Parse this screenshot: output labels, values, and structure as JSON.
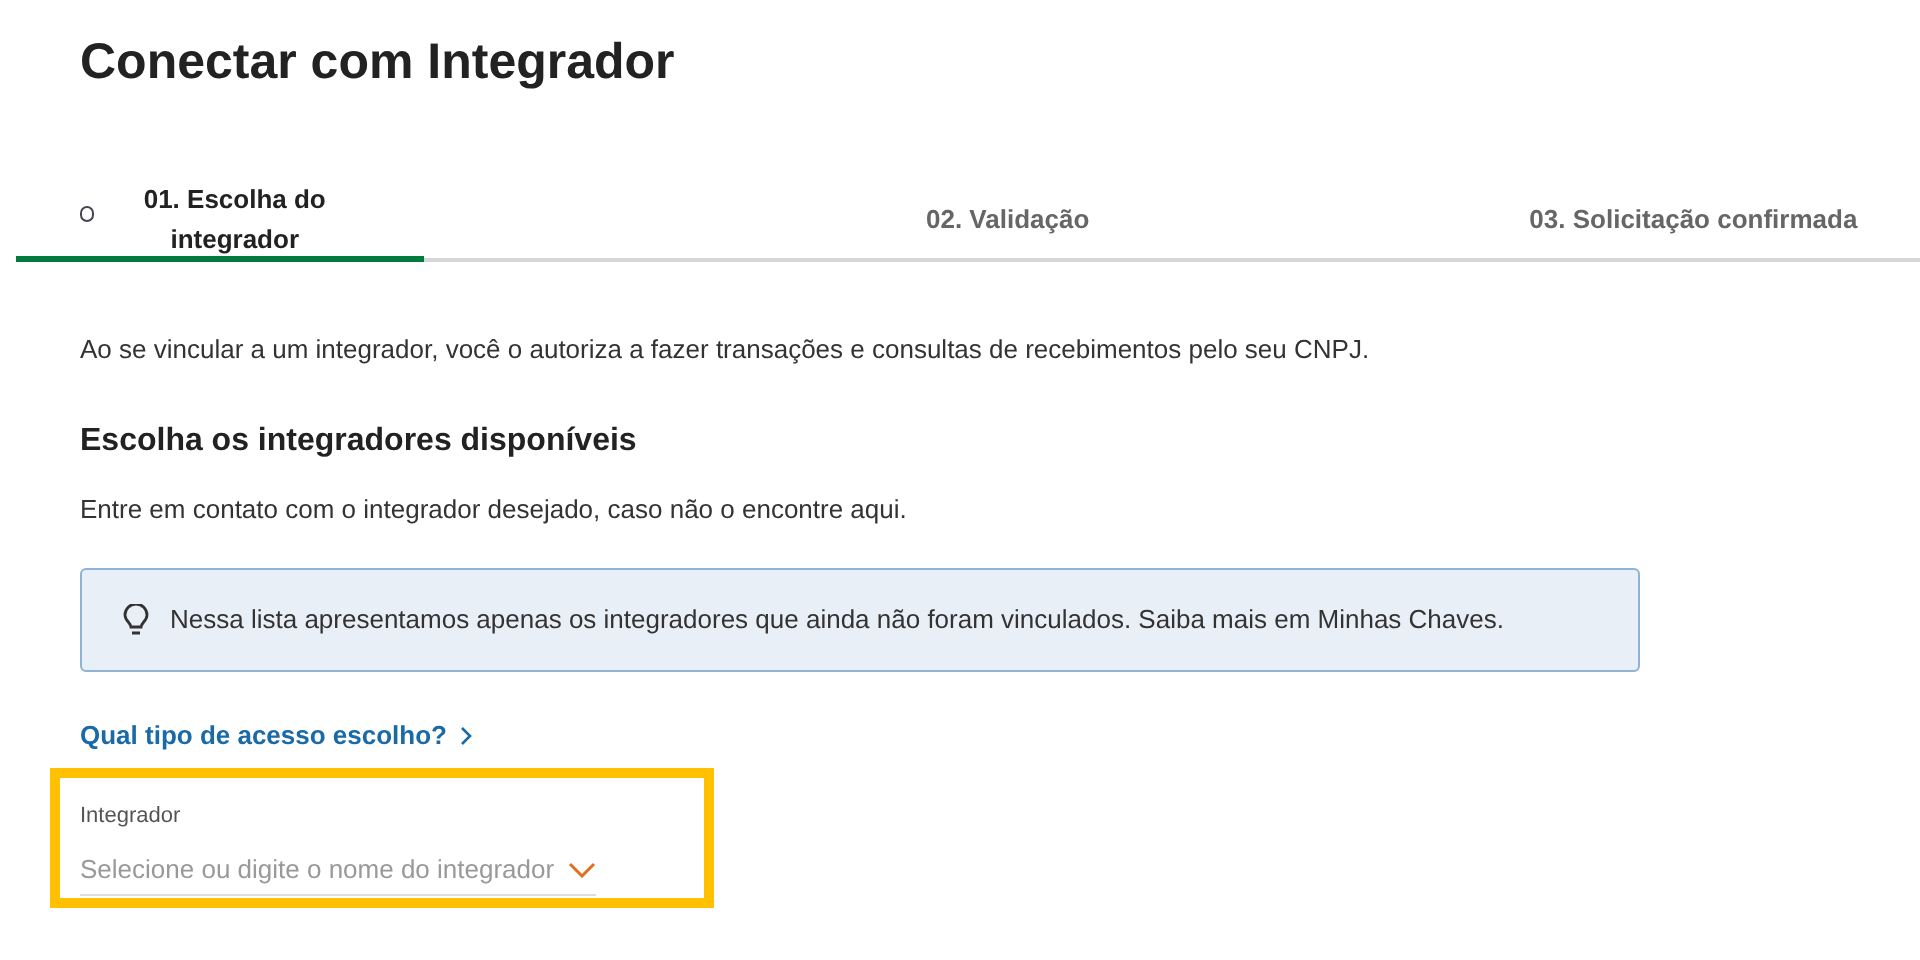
{
  "title": "Conectar com Integrador",
  "steps": [
    {
      "label": "01. Escolha do integrador",
      "selected": true
    },
    {
      "label": "02. Validação",
      "selected": false
    },
    {
      "label": "03. Solicitação confirmada",
      "selected": false
    }
  ],
  "intro": "Ao se vincular a um integrador, você o autoriza a fazer transações e consultas de recebimentos pelo seu CNPJ.",
  "section_title": "Escolha os integradores disponíveis",
  "section_text": "Entre em contato com o integrador desejado, caso não o encontre aqui.",
  "info": "Nessa lista apresentamos apenas os integradores que ainda não foram vinculados. Saiba mais em Minhas Chaves.",
  "link": "Qual tipo de acesso escolho?",
  "field": {
    "label": "Integrador",
    "placeholder": "Selecione ou digite o nome do integrador"
  }
}
